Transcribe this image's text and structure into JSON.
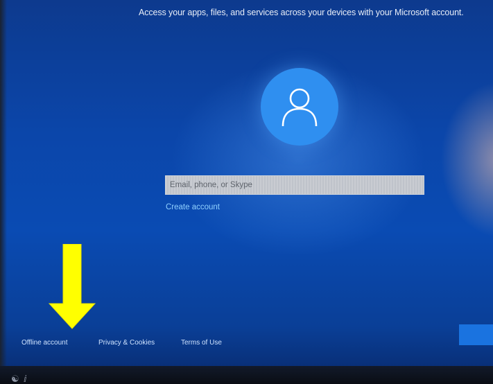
{
  "header": {
    "subtitle": "Access your apps, files, and services across your devices with your Microsoft account."
  },
  "avatar": {
    "icon": "user-icon",
    "color": "#2f8ff0"
  },
  "signin": {
    "email_placeholder": "Email, phone, or Skype",
    "create_account_label": "Create account"
  },
  "annotation": {
    "icon": "down-arrow-icon",
    "color": "#ffff00"
  },
  "footer": {
    "links": [
      {
        "label": "Offline account"
      },
      {
        "label": "Privacy & Cookies"
      },
      {
        "label": "Terms of Use"
      }
    ]
  },
  "buttons": {
    "next_color": "#1a73e0"
  },
  "taskbar": {
    "icons": [
      "accessibility-icon",
      "microphone-icon"
    ]
  },
  "colors": {
    "background": "#0a4bb3",
    "link": "#8fd0ff"
  }
}
